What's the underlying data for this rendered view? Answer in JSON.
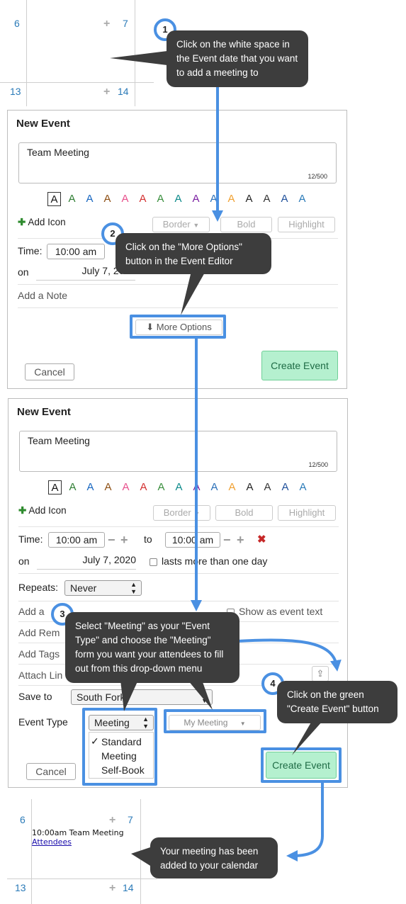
{
  "top_calendar": {
    "day_left": "6",
    "day_right": "7",
    "day_bottom_left": "13",
    "day_bottom_right": "14"
  },
  "bottom_calendar": {
    "day_left": "6",
    "day_right": "7",
    "day_bottom_left": "13",
    "day_bottom_right": "14",
    "event_text": "10:00am Team Meeting",
    "event_link": "Attendees"
  },
  "steps": {
    "s1": {
      "num": "1",
      "text": "Click on the white space in the Event date  that you want to add a meeting to"
    },
    "s2": {
      "num": "2",
      "text": "Click on the \"More Options\" button in the Event Editor"
    },
    "s3": {
      "num": "3",
      "text": "Select \"Meeting\" as your \"Event Type\" and choose the \"Meeting\" form you want your attendees to fill out from this drop-down menu"
    },
    "s4": {
      "num": "4",
      "text": "Click on the green \"Create Event\" button"
    },
    "s5": {
      "text": "Your meeting has been added to your calendar"
    }
  },
  "editor1": {
    "title": "New Event",
    "event_name": "Team Meeting",
    "char_count": "12/500",
    "add_icon": "Add Icon",
    "border": "Border",
    "bold": "Bold",
    "highlight": "Highlight",
    "time_label": "Time:",
    "start_time": "10:00 am",
    "on_label": "on",
    "date": "July 7, 2020",
    "add_note": "Add a Note",
    "more_options": "More Options",
    "cancel": "Cancel",
    "create": "Create Event"
  },
  "editor2": {
    "title": "New Event",
    "event_name": "Team Meeting",
    "char_count": "12/500",
    "add_icon": "Add Icon",
    "border": "Border",
    "bold": "Bold",
    "highlight": "Highlight",
    "time_label": "Time:",
    "start_time": "10:00 am",
    "to_label": "to",
    "end_time": "10:00 am",
    "on_label": "on",
    "date": "July 7, 2020",
    "multi_day": "lasts more than one day",
    "repeats_label": "Repeats:",
    "repeats_value": "Never",
    "add_a": "Add a",
    "add_rem": "Add Rem",
    "add_tags": "Add Tags",
    "attach_lin": "Attach Lin",
    "show_as_event_text": "Show as event text",
    "save_to_label": "Save to",
    "save_to_value": "South Fork",
    "event_type_label": "Event Type",
    "event_type_value": "Meeting",
    "form_value": "My Meeting",
    "dropdown": [
      "Standard",
      "Meeting",
      "Self-Book"
    ],
    "checkmark": "✓",
    "cancel": "Cancel",
    "create": "Create Event"
  },
  "swatches": [
    {
      "c": "#111111"
    },
    {
      "c": "#2e7d32"
    },
    {
      "c": "#1565c0"
    },
    {
      "c": "#8d4e12"
    },
    {
      "c": "#e84f8c"
    },
    {
      "c": "#d32f2f"
    },
    {
      "c": "#388e3c"
    },
    {
      "c": "#0b8a8a"
    },
    {
      "c": "#7b1fa2"
    },
    {
      "c": "#2a6fb8"
    },
    {
      "c": "#f0a030"
    },
    {
      "c": "#222222"
    },
    {
      "c": "#333333"
    },
    {
      "c": "#1e4f9a"
    },
    {
      "c": "#2a7ab8"
    }
  ],
  "swatch_letter": "A",
  "colors": {
    "callout_bg": "#3d3d3d",
    "highlight_border": "#4a90e2",
    "create_green": "#b5f0cf",
    "delete_red": "#c62828"
  }
}
